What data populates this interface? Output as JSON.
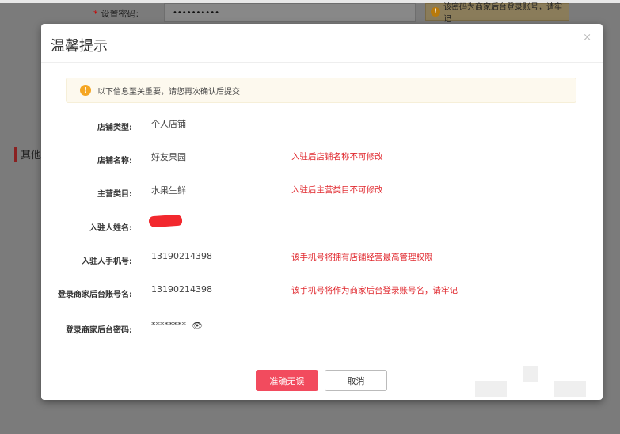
{
  "background": {
    "password_label": "设置密码:",
    "password_value": "••••••••••",
    "password_tip": "该密码为商家后台登录账号，请牢记",
    "section_title": "其他"
  },
  "modal": {
    "title": "温馨提示",
    "close_label": "×",
    "notice": "以下信息至关重要，请您再次确认后提交",
    "rows": [
      {
        "label": "店铺类型:",
        "value": "个人店铺",
        "note": ""
      },
      {
        "label": "店铺名称:",
        "value": "好友果园",
        "note": "入驻后店铺名称不可修改"
      },
      {
        "label": "主营类目:",
        "value": "水果生鲜",
        "note": "入驻后主营类目不可修改"
      },
      {
        "label": "入驻人姓名:",
        "value": "",
        "note": ""
      },
      {
        "label": "入驻人手机号:",
        "value": "13190214398",
        "note": "该手机号将拥有店铺经营最高管理权限"
      },
      {
        "label": "登录商家后台账号名:",
        "value": "13190214398",
        "note": "该手机号将作为商家后台登录账号名，请牢记"
      },
      {
        "label": "登录商家后台密码:",
        "value": "********",
        "note": ""
      }
    ],
    "confirm_label": "准确无误",
    "cancel_label": "取消"
  },
  "colors": {
    "primary": "#f24b5e",
    "warning": "#e0282e"
  }
}
